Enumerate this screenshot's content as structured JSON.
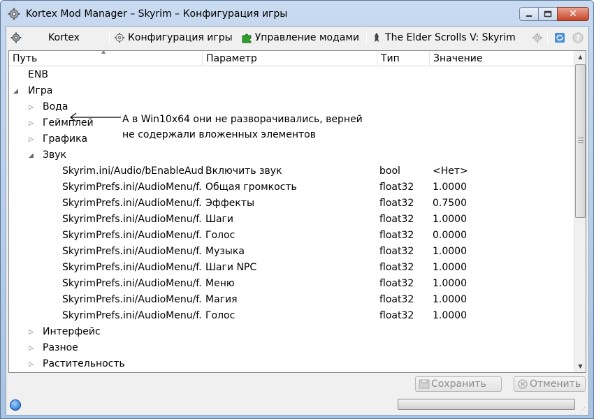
{
  "window": {
    "title": "Kortex Mod Manager – Skyrim – Конфигурация игры",
    "minimize_glyph": "▁",
    "maximize_glyph": "▢",
    "close_glyph": "✕"
  },
  "toolbar": {
    "kortex_label": "Kortex",
    "game_config_label": "Конфигурация игры",
    "mod_management_label": "Управление модами",
    "game_label": "The Elder Scrolls V: Skyrim"
  },
  "tree": {
    "columns": [
      "Путь",
      "Параметр",
      "Тип",
      "Значение"
    ],
    "rows": [
      {
        "path": "ENB",
        "param": "",
        "type": "",
        "value": "",
        "level": 0,
        "expander": ""
      },
      {
        "path": "Игра",
        "param": "",
        "type": "",
        "value": "",
        "level": 0,
        "expander": "◢"
      },
      {
        "path": "Вода",
        "param": "",
        "type": "",
        "value": "",
        "level": 1,
        "expander": "▷"
      },
      {
        "path": "Геймплей",
        "param": "",
        "type": "",
        "value": "",
        "level": 1,
        "expander": "▷"
      },
      {
        "path": "Графика",
        "param": "",
        "type": "",
        "value": "",
        "level": 1,
        "expander": "▷"
      },
      {
        "path": "Звук",
        "param": "",
        "type": "",
        "value": "",
        "level": 1,
        "expander": "◢"
      },
      {
        "path": "Skyrim.ini/Audio/bEnableAud...",
        "param": "Включить звук",
        "type": "bool",
        "value": "<Нет>",
        "level": 2,
        "expander": ""
      },
      {
        "path": "SkyrimPrefs.ini/AudioMenu/f...",
        "param": "Общая громкость",
        "type": "float32",
        "value": "1.0000",
        "level": 2,
        "expander": ""
      },
      {
        "path": "SkyrimPrefs.ini/AudioMenu/f...",
        "param": "Эффекты",
        "type": "float32",
        "value": "0.7500",
        "level": 2,
        "expander": ""
      },
      {
        "path": "SkyrimPrefs.ini/AudioMenu/f...",
        "param": "Шаги",
        "type": "float32",
        "value": "1.0000",
        "level": 2,
        "expander": ""
      },
      {
        "path": "SkyrimPrefs.ini/AudioMenu/f...",
        "param": "Голос",
        "type": "float32",
        "value": "0.0000",
        "level": 2,
        "expander": ""
      },
      {
        "path": "SkyrimPrefs.ini/AudioMenu/f...",
        "param": "Музыка",
        "type": "float32",
        "value": "1.0000",
        "level": 2,
        "expander": ""
      },
      {
        "path": "SkyrimPrefs.ini/AudioMenu/f...",
        "param": "Шаги NPC",
        "type": "float32",
        "value": "1.0000",
        "level": 2,
        "expander": ""
      },
      {
        "path": "SkyrimPrefs.ini/AudioMenu/f...",
        "param": "Меню",
        "type": "float32",
        "value": "1.0000",
        "level": 2,
        "expander": ""
      },
      {
        "path": "SkyrimPrefs.ini/AudioMenu/f...",
        "param": "Магия",
        "type": "float32",
        "value": "1.0000",
        "level": 2,
        "expander": ""
      },
      {
        "path": "SkyrimPrefs.ini/AudioMenu/f...",
        "param": "Голос",
        "type": "float32",
        "value": "1.0000",
        "level": 2,
        "expander": ""
      },
      {
        "path": "Интерфейс",
        "param": "",
        "type": "",
        "value": "",
        "level": 1,
        "expander": "▷"
      },
      {
        "path": "Разное",
        "param": "",
        "type": "",
        "value": "",
        "level": 1,
        "expander": "▷"
      },
      {
        "path": "Растительность",
        "param": "",
        "type": "",
        "value": "",
        "level": 1,
        "expander": "▷"
      }
    ]
  },
  "annotation": {
    "line1": "А в Win10x64 они не разворачивались, верней",
    "line2": "не содержали вложенных элементов"
  },
  "buttons": {
    "save_label": "Сохранить",
    "cancel_label": "Отменить"
  },
  "colors": {
    "accent": "#1565c0",
    "mod_icon": "#2e9e2e"
  }
}
